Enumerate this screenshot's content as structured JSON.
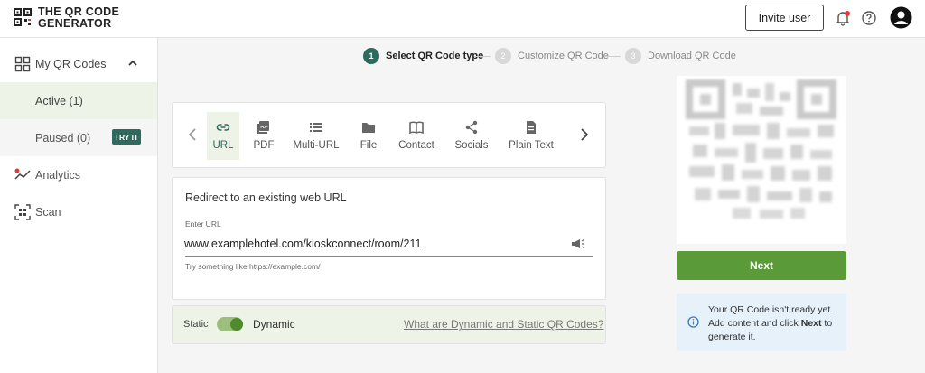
{
  "header": {
    "logo_line1": "THE QR CODE",
    "logo_line2": "GENERATOR",
    "invite_label": "Invite user",
    "icons": [
      "bell-icon",
      "help-icon",
      "account-icon"
    ]
  },
  "sidebar": {
    "my_qr_codes": "My QR Codes",
    "active": "Active (1)",
    "paused": "Paused (0)",
    "analytics": "Analytics",
    "try_badge": "TRY IT",
    "scan": "Scan"
  },
  "stepper": {
    "steps": [
      {
        "num": "1",
        "label": "Select QR Code type"
      },
      {
        "num": "2",
        "label": "Customize QR Code"
      },
      {
        "num": "3",
        "label": "Download QR Code"
      }
    ]
  },
  "types": {
    "items": [
      {
        "label": "URL",
        "icon": "link-icon"
      },
      {
        "label": "PDF",
        "icon": "pdf-icon"
      },
      {
        "label": "Multi-URL",
        "icon": "list-icon"
      },
      {
        "label": "File",
        "icon": "folder-icon"
      },
      {
        "label": "Contact",
        "icon": "contact-book-icon"
      },
      {
        "label": "Socials",
        "icon": "share-icon"
      },
      {
        "label": "Plain Text",
        "icon": "document-icon"
      }
    ]
  },
  "url_form": {
    "title": "Redirect to an existing web URL",
    "label": "Enter URL",
    "value": "www.examplehotel.com/kioskconnect/room/211",
    "hint": "Try something like https://example.com/"
  },
  "toggle": {
    "static_label": "Static",
    "dynamic_label": "Dynamic",
    "help_link": "What are Dynamic and Static QR Codes?"
  },
  "preview": {
    "next_label": "Next",
    "info_part1": "Your QR Code isn't ready yet. Add content and click ",
    "info_bold": "Next",
    "info_part2": " to generate it."
  },
  "colors": {
    "brand_green": "#2e6b5e",
    "button_green": "#5a9a38",
    "info_blue": "#e6f1fa"
  }
}
